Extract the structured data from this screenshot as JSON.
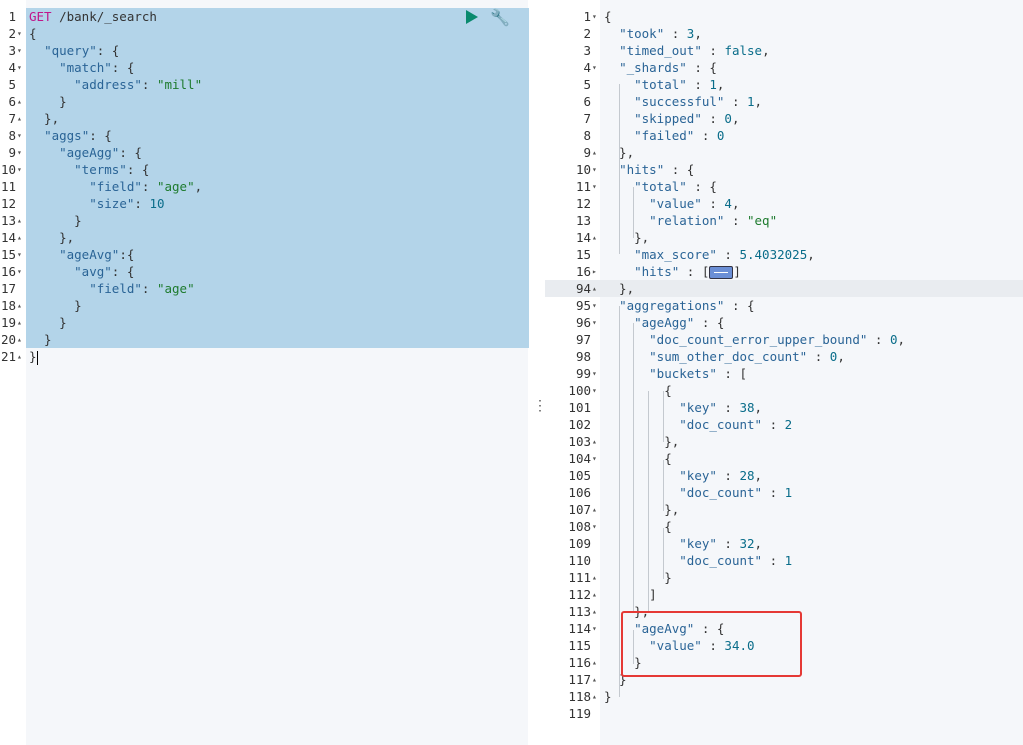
{
  "request": {
    "method": "GET",
    "path": "/bank/_search",
    "lines": [
      {
        "n": "1",
        "fold": "",
        "parts": [
          [
            "m",
            "GET"
          ],
          [
            "p",
            " /bank/_search"
          ]
        ]
      },
      {
        "n": "2",
        "fold": "▾",
        "parts": [
          [
            "p",
            "{"
          ]
        ]
      },
      {
        "n": "3",
        "fold": "▾",
        "parts": [
          [
            "p",
            "  "
          ],
          [
            "k",
            "\"query\""
          ],
          [
            "p",
            ": {"
          ]
        ]
      },
      {
        "n": "4",
        "fold": "▾",
        "parts": [
          [
            "p",
            "    "
          ],
          [
            "k",
            "\"match\""
          ],
          [
            "p",
            ": {"
          ]
        ]
      },
      {
        "n": "5",
        "fold": "",
        "parts": [
          [
            "p",
            "      "
          ],
          [
            "k",
            "\"address\""
          ],
          [
            "p",
            ": "
          ],
          [
            "s",
            "\"mill\""
          ]
        ]
      },
      {
        "n": "6",
        "fold": "▴",
        "parts": [
          [
            "p",
            "    }"
          ]
        ]
      },
      {
        "n": "7",
        "fold": "▴",
        "parts": [
          [
            "p",
            "  },"
          ]
        ]
      },
      {
        "n": "8",
        "fold": "▾",
        "parts": [
          [
            "p",
            "  "
          ],
          [
            "k",
            "\"aggs\""
          ],
          [
            "p",
            ": {"
          ]
        ]
      },
      {
        "n": "9",
        "fold": "▾",
        "parts": [
          [
            "p",
            "    "
          ],
          [
            "k",
            "\"ageAgg\""
          ],
          [
            "p",
            ": {"
          ]
        ]
      },
      {
        "n": "10",
        "fold": "▾",
        "parts": [
          [
            "p",
            "      "
          ],
          [
            "k",
            "\"terms\""
          ],
          [
            "p",
            ": {"
          ]
        ]
      },
      {
        "n": "11",
        "fold": "",
        "parts": [
          [
            "p",
            "        "
          ],
          [
            "k",
            "\"field\""
          ],
          [
            "p",
            ": "
          ],
          [
            "s",
            "\"age\""
          ],
          [
            "p",
            ","
          ]
        ]
      },
      {
        "n": "12",
        "fold": "",
        "parts": [
          [
            "p",
            "        "
          ],
          [
            "k",
            "\"size\""
          ],
          [
            "p",
            ": "
          ],
          [
            "n",
            "10"
          ]
        ]
      },
      {
        "n": "13",
        "fold": "▴",
        "parts": [
          [
            "p",
            "      }"
          ]
        ]
      },
      {
        "n": "14",
        "fold": "▴",
        "parts": [
          [
            "p",
            "    },"
          ]
        ]
      },
      {
        "n": "15",
        "fold": "▾",
        "parts": [
          [
            "p",
            "    "
          ],
          [
            "k",
            "\"ageAvg\""
          ],
          [
            "p",
            ":{"
          ]
        ]
      },
      {
        "n": "16",
        "fold": "▾",
        "parts": [
          [
            "p",
            "      "
          ],
          [
            "k",
            "\"avg\""
          ],
          [
            "p",
            ": {"
          ]
        ]
      },
      {
        "n": "17",
        "fold": "",
        "parts": [
          [
            "p",
            "        "
          ],
          [
            "k",
            "\"field\""
          ],
          [
            "p",
            ": "
          ],
          [
            "s",
            "\"age\""
          ]
        ]
      },
      {
        "n": "18",
        "fold": "▴",
        "parts": [
          [
            "p",
            "      }"
          ]
        ]
      },
      {
        "n": "19",
        "fold": "▴",
        "parts": [
          [
            "p",
            "    }"
          ]
        ]
      },
      {
        "n": "20",
        "fold": "▴",
        "parts": [
          [
            "p",
            "  }"
          ]
        ]
      },
      {
        "n": "21",
        "fold": "▴",
        "parts": [
          [
            "p",
            "}"
          ]
        ]
      }
    ]
  },
  "response": {
    "lines": [
      {
        "n": "1",
        "fold": "▾",
        "parts": [
          [
            "p",
            "{"
          ]
        ]
      },
      {
        "n": "2",
        "fold": "",
        "parts": [
          [
            "p",
            "  "
          ],
          [
            "k",
            "\"took\""
          ],
          [
            "p",
            " : "
          ],
          [
            "n",
            "3"
          ],
          [
            "p",
            ","
          ]
        ]
      },
      {
        "n": "3",
        "fold": "",
        "parts": [
          [
            "p",
            "  "
          ],
          [
            "k",
            "\"timed_out\""
          ],
          [
            "p",
            " : "
          ],
          [
            "n",
            "false"
          ],
          [
            "p",
            ","
          ]
        ]
      },
      {
        "n": "4",
        "fold": "▾",
        "parts": [
          [
            "p",
            "  "
          ],
          [
            "k",
            "\"_shards\""
          ],
          [
            "p",
            " : {"
          ]
        ]
      },
      {
        "n": "5",
        "fold": "",
        "parts": [
          [
            "p",
            "    "
          ],
          [
            "k",
            "\"total\""
          ],
          [
            "p",
            " : "
          ],
          [
            "n",
            "1"
          ],
          [
            "p",
            ","
          ]
        ]
      },
      {
        "n": "6",
        "fold": "",
        "parts": [
          [
            "p",
            "    "
          ],
          [
            "k",
            "\"successful\""
          ],
          [
            "p",
            " : "
          ],
          [
            "n",
            "1"
          ],
          [
            "p",
            ","
          ]
        ]
      },
      {
        "n": "7",
        "fold": "",
        "parts": [
          [
            "p",
            "    "
          ],
          [
            "k",
            "\"skipped\""
          ],
          [
            "p",
            " : "
          ],
          [
            "n",
            "0"
          ],
          [
            "p",
            ","
          ]
        ]
      },
      {
        "n": "8",
        "fold": "",
        "parts": [
          [
            "p",
            "    "
          ],
          [
            "k",
            "\"failed\""
          ],
          [
            "p",
            " : "
          ],
          [
            "n",
            "0"
          ]
        ]
      },
      {
        "n": "9",
        "fold": "▴",
        "parts": [
          [
            "p",
            "  },"
          ]
        ]
      },
      {
        "n": "10",
        "fold": "▾",
        "parts": [
          [
            "p",
            "  "
          ],
          [
            "k",
            "\"hits\""
          ],
          [
            "p",
            " : {"
          ]
        ]
      },
      {
        "n": "11",
        "fold": "▾",
        "parts": [
          [
            "p",
            "    "
          ],
          [
            "k",
            "\"total\""
          ],
          [
            "p",
            " : {"
          ]
        ]
      },
      {
        "n": "12",
        "fold": "",
        "parts": [
          [
            "p",
            "      "
          ],
          [
            "k",
            "\"value\""
          ],
          [
            "p",
            " : "
          ],
          [
            "n",
            "4"
          ],
          [
            "p",
            ","
          ]
        ]
      },
      {
        "n": "13",
        "fold": "",
        "parts": [
          [
            "p",
            "      "
          ],
          [
            "k",
            "\"relation\""
          ],
          [
            "p",
            " : "
          ],
          [
            "s",
            "\"eq\""
          ]
        ]
      },
      {
        "n": "14",
        "fold": "▴",
        "parts": [
          [
            "p",
            "    },"
          ]
        ]
      },
      {
        "n": "15",
        "fold": "",
        "parts": [
          [
            "p",
            "    "
          ],
          [
            "k",
            "\"max_score\""
          ],
          [
            "p",
            " : "
          ],
          [
            "n",
            "5.4032025"
          ],
          [
            "p",
            ","
          ]
        ]
      },
      {
        "n": "16",
        "fold": "▸",
        "parts": [
          [
            "p",
            "    "
          ],
          [
            "k",
            "\"hits\""
          ],
          [
            "p",
            " : ["
          ],
          [
            "c",
            ""
          ],
          [
            "p",
            "]"
          ]
        ]
      },
      {
        "n": "94",
        "fold": "▴",
        "hl": true,
        "parts": [
          [
            "p",
            "  },"
          ]
        ]
      },
      {
        "n": "95",
        "fold": "▾",
        "parts": [
          [
            "p",
            "  "
          ],
          [
            "k",
            "\"aggregations\""
          ],
          [
            "p",
            " : {"
          ]
        ]
      },
      {
        "n": "96",
        "fold": "▾",
        "parts": [
          [
            "p",
            "    "
          ],
          [
            "k",
            "\"ageAgg\""
          ],
          [
            "p",
            " : {"
          ]
        ]
      },
      {
        "n": "97",
        "fold": "",
        "parts": [
          [
            "p",
            "      "
          ],
          [
            "k",
            "\"doc_count_error_upper_bound\""
          ],
          [
            "p",
            " : "
          ],
          [
            "n",
            "0"
          ],
          [
            "p",
            ","
          ]
        ]
      },
      {
        "n": "98",
        "fold": "",
        "parts": [
          [
            "p",
            "      "
          ],
          [
            "k",
            "\"sum_other_doc_count\""
          ],
          [
            "p",
            " : "
          ],
          [
            "n",
            "0"
          ],
          [
            "p",
            ","
          ]
        ]
      },
      {
        "n": "99",
        "fold": "▾",
        "parts": [
          [
            "p",
            "      "
          ],
          [
            "k",
            "\"buckets\""
          ],
          [
            "p",
            " : ["
          ]
        ]
      },
      {
        "n": "100",
        "fold": "▾",
        "parts": [
          [
            "p",
            "        {"
          ]
        ]
      },
      {
        "n": "101",
        "fold": "",
        "parts": [
          [
            "p",
            "          "
          ],
          [
            "k",
            "\"key\""
          ],
          [
            "p",
            " : "
          ],
          [
            "n",
            "38"
          ],
          [
            "p",
            ","
          ]
        ]
      },
      {
        "n": "102",
        "fold": "",
        "parts": [
          [
            "p",
            "          "
          ],
          [
            "k",
            "\"doc_count\""
          ],
          [
            "p",
            " : "
          ],
          [
            "n",
            "2"
          ]
        ]
      },
      {
        "n": "103",
        "fold": "▴",
        "parts": [
          [
            "p",
            "        },"
          ]
        ]
      },
      {
        "n": "104",
        "fold": "▾",
        "parts": [
          [
            "p",
            "        {"
          ]
        ]
      },
      {
        "n": "105",
        "fold": "",
        "parts": [
          [
            "p",
            "          "
          ],
          [
            "k",
            "\"key\""
          ],
          [
            "p",
            " : "
          ],
          [
            "n",
            "28"
          ],
          [
            "p",
            ","
          ]
        ]
      },
      {
        "n": "106",
        "fold": "",
        "parts": [
          [
            "p",
            "          "
          ],
          [
            "k",
            "\"doc_count\""
          ],
          [
            "p",
            " : "
          ],
          [
            "n",
            "1"
          ]
        ]
      },
      {
        "n": "107",
        "fold": "▴",
        "parts": [
          [
            "p",
            "        },"
          ]
        ]
      },
      {
        "n": "108",
        "fold": "▾",
        "parts": [
          [
            "p",
            "        {"
          ]
        ]
      },
      {
        "n": "109",
        "fold": "",
        "parts": [
          [
            "p",
            "          "
          ],
          [
            "k",
            "\"key\""
          ],
          [
            "p",
            " : "
          ],
          [
            "n",
            "32"
          ],
          [
            "p",
            ","
          ]
        ]
      },
      {
        "n": "110",
        "fold": "",
        "parts": [
          [
            "p",
            "          "
          ],
          [
            "k",
            "\"doc_count\""
          ],
          [
            "p",
            " : "
          ],
          [
            "n",
            "1"
          ]
        ]
      },
      {
        "n": "111",
        "fold": "▴",
        "parts": [
          [
            "p",
            "        }"
          ]
        ]
      },
      {
        "n": "112",
        "fold": "▴",
        "parts": [
          [
            "p",
            "      ]"
          ]
        ]
      },
      {
        "n": "113",
        "fold": "▴",
        "parts": [
          [
            "p",
            "    },"
          ]
        ]
      },
      {
        "n": "114",
        "fold": "▾",
        "parts": [
          [
            "p",
            "    "
          ],
          [
            "k",
            "\"ageAvg\""
          ],
          [
            "p",
            " : {"
          ]
        ]
      },
      {
        "n": "115",
        "fold": "",
        "parts": [
          [
            "p",
            "      "
          ],
          [
            "k",
            "\"value\""
          ],
          [
            "p",
            " : "
          ],
          [
            "n",
            "34.0"
          ]
        ]
      },
      {
        "n": "116",
        "fold": "▴",
        "parts": [
          [
            "p",
            "    }"
          ]
        ]
      },
      {
        "n": "117",
        "fold": "▴",
        "parts": [
          [
            "p",
            "  }"
          ]
        ]
      },
      {
        "n": "118",
        "fold": "▴",
        "parts": [
          [
            "p",
            "}"
          ]
        ]
      },
      {
        "n": "119",
        "fold": "",
        "parts": []
      }
    ]
  },
  "icons": {
    "run": "play-icon",
    "settings": "wrench-icon",
    "divider": "vertical-dots-icon"
  },
  "colors": {
    "selection": "#b3d4e9",
    "string": "#1e7b2e",
    "key": "#2a6496",
    "method": "#c0168a",
    "highlight_box": "#e53935"
  }
}
